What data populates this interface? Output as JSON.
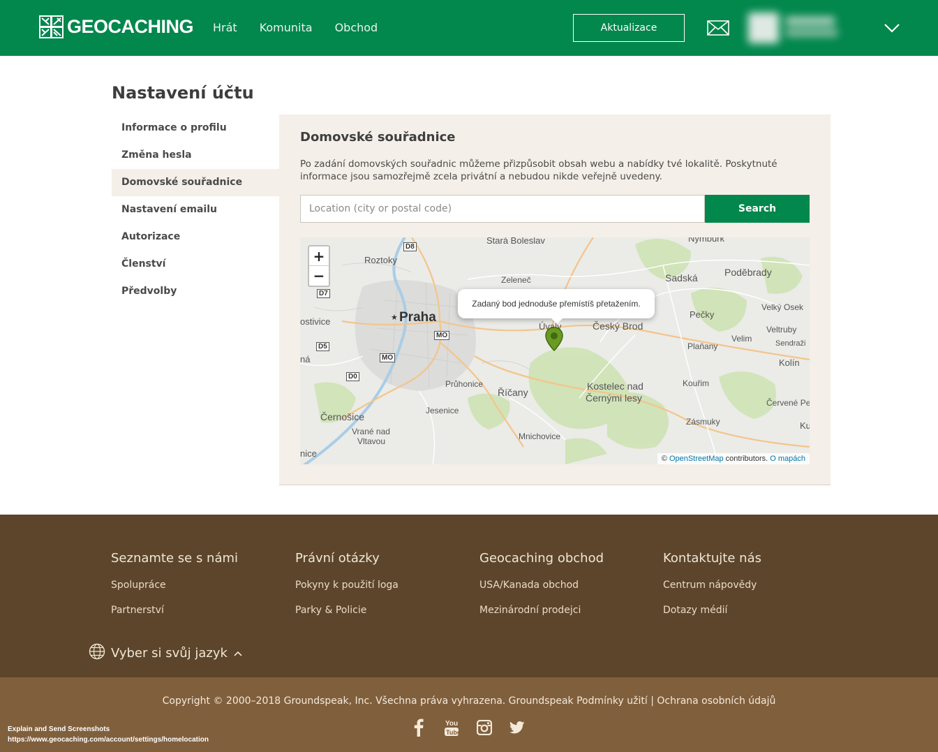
{
  "header": {
    "brand": "GEOCACHING",
    "nav": [
      "Hrát",
      "Komunita",
      "Obchod"
    ],
    "update_button": "Aktualizace",
    "brand_color": "#02874d"
  },
  "page": {
    "title": "Nastavení účtu"
  },
  "sidebar": {
    "items": [
      {
        "label": "Informace o profilu"
      },
      {
        "label": "Změna hesla"
      },
      {
        "label": "Domovské souřadnice",
        "active": true
      },
      {
        "label": "Nastavení emailu"
      },
      {
        "label": "Autorizace"
      },
      {
        "label": "Členství"
      },
      {
        "label": "Předvolby"
      }
    ]
  },
  "panel": {
    "title": "Domovské souřadnice",
    "description": "Po zadání domovských souřadnic můžeme přizpůsobit obsah webu a nabídky tvé lokalitě. Poskytnuté informace jsou samozřejmě zcela privátní a nebudou nikde veřejně uvedeny.",
    "search_placeholder": "Location (city or postal code)",
    "search_value": "",
    "search_button": "Search"
  },
  "map": {
    "tooltip": "Zadaný bod jednoduše přemístíš přetažením.",
    "zoom_in": "+",
    "zoom_out": "−",
    "attribution_prefix": "©",
    "attribution_link": "OpenStreetMap",
    "attribution_suffix": "contributors.",
    "attribution_about": "O mapách",
    "marker_color": "#5e8a1a",
    "labels": {
      "stara_boleslav": "Stará Boleslav",
      "nymburk": "Nymburk",
      "roztoky": "Roztoky",
      "zelenec": "Zeleneč",
      "sadska": "Sadská",
      "podebrady": "Poděbrady",
      "praha": "Praha",
      "ostivice": "ostivice",
      "uvaly": "Úvaly",
      "cesky_brod": "Český Brod",
      "pecky": "Pečky",
      "velky_osek": "Velký Osek",
      "veltruby": "Veltruby",
      "velim": "Velim",
      "planany": "Plaňany",
      "sendrazice": "Sendraži",
      "kolin": "Kolín",
      "na": "ná",
      "pruhonice": "Průhonice",
      "ricany": "Říčany",
      "kostelec": "Kostelec nad",
      "cernymi": "Černými lesy",
      "kourim": "Kouřim",
      "cerven": "Červené Pe",
      "jesenice": "Jesenice",
      "cernosice": "Černošice",
      "vrane": "Vrané nad",
      "vltavou": "Vltavou",
      "zasmuky": "Zásmuky",
      "ku": "Ku",
      "mnichovice": "Mnichovice",
      "nice": "nice",
      "shield_d8": "D8",
      "shield_d7": "D7",
      "shield_d5": "D5",
      "shield_d0": "D0",
      "shield_mo1": "MO",
      "shield_mo2": "MO"
    }
  },
  "footer": {
    "columns": [
      {
        "heading": "Seznamte se s námi",
        "links": [
          "Spolupráce",
          "Partnerství"
        ]
      },
      {
        "heading": "Právní otázky",
        "links": [
          "Pokyny k použití loga",
          "Parky & Policie"
        ]
      },
      {
        "heading": "Geocaching obchod",
        "links": [
          "USA/Kanada obchod",
          "Mezinárodní prodejci"
        ]
      },
      {
        "heading": "Kontaktujte nás",
        "links": [
          "Centrum nápovědy",
          "Dotazy médií"
        ]
      }
    ],
    "language": "Vyber si svůj jazyk",
    "copyright": "Copyright © 2000–2018 Groundspeak, Inc. Všechna práva vyhrazena. Groundspeak Podmínky užití | Ochrana osobních údajů",
    "social": [
      "facebook-icon",
      "youtube-icon",
      "instagram-icon",
      "twitter-icon"
    ],
    "footer_bg": "#5c452b",
    "bottom_bg": "#805f3d"
  },
  "overlay": {
    "line1": "Explain and Send Screenshots",
    "line2": "https://www.geocaching.com/account/settings/homelocation"
  }
}
